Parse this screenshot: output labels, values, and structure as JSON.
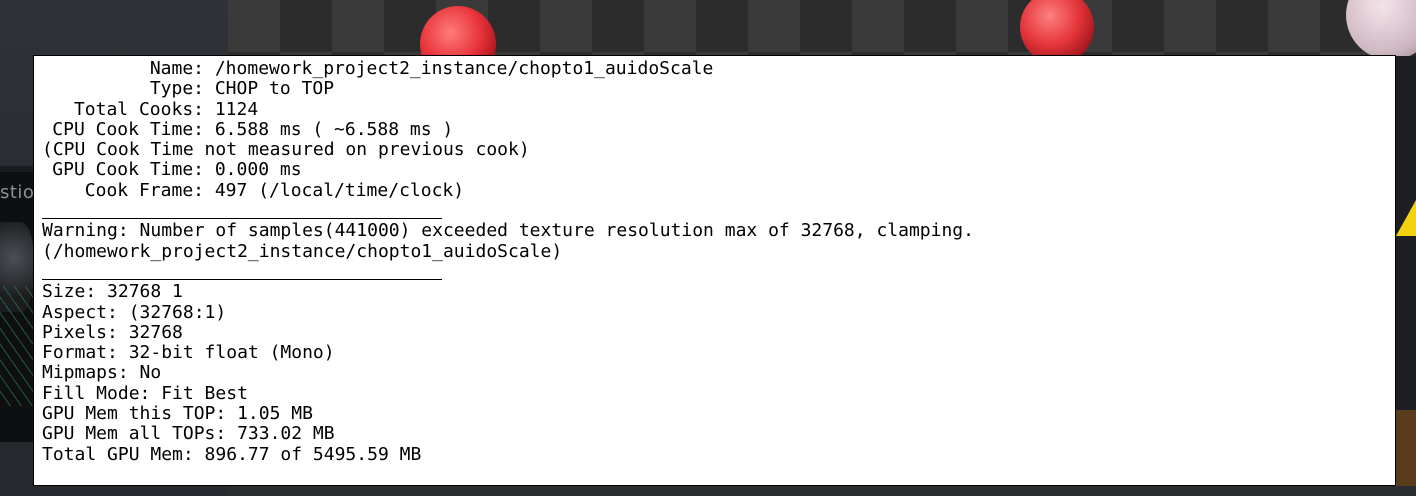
{
  "left_panel": {
    "label": "stio"
  },
  "info": {
    "name_label": "Name:",
    "name_value": "/homework_project2_instance/chopto1_auidoScale",
    "type_label": "Type:",
    "type_value": "CHOP to TOP",
    "total_cooks_label": "Total Cooks:",
    "total_cooks_value": "1124",
    "cpu_cook_label": "CPU Cook Time:",
    "cpu_cook_value": "6.588 ms ( ~6.588 ms )",
    "cpu_note": "(CPU Cook Time not measured on previous cook)",
    "gpu_cook_label": "GPU Cook Time:",
    "gpu_cook_value": "0.000 ms",
    "cook_frame_label": "Cook Frame:",
    "cook_frame_value": "497 (/local/time/clock)",
    "warning_line1": "Warning: Number of samples(441000) exceeded texture resolution max of 32768, clamping.",
    "warning_line2": "(/homework_project2_instance/chopto1_auidoScale)",
    "stats": [
      "Size: 32768 1",
      "Aspect: (32768:1)",
      "Pixels: 32768",
      "Format: 32-bit float (Mono)",
      "Mipmaps: No",
      "Fill Mode: Fit Best",
      "GPU Mem this TOP: 1.05 MB",
      "GPU Mem all TOPs: 733.02 MB",
      "Total GPU Mem: 896.77 of 5495.59 MB"
    ]
  },
  "colors": {
    "popup_bg": "#ffffff",
    "text": "#000000",
    "warning_yellow": "#f2d30f",
    "ball_red": "#e8343a"
  }
}
